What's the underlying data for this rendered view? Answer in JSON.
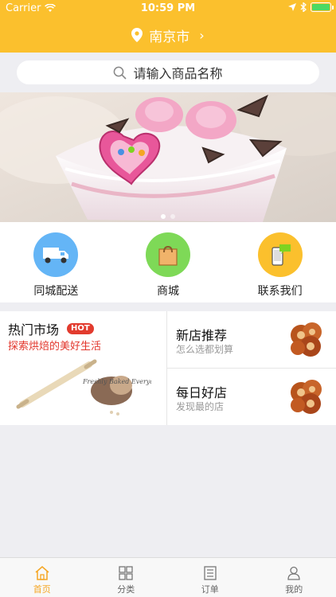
{
  "status_bar": {
    "carrier": "Carrier",
    "time": "10:59 PM"
  },
  "header": {
    "city": "南京市"
  },
  "search": {
    "placeholder": "请输入商品名称"
  },
  "quick_links": [
    {
      "label": "同城配送",
      "icon": "delivery-truck-icon",
      "color": "#64b5f6"
    },
    {
      "label": "商城",
      "icon": "shopping-bag-icon",
      "color": "#7ed957"
    },
    {
      "label": "联系我们",
      "icon": "phone-message-icon",
      "color": "#fbc02d"
    }
  ],
  "market": {
    "title": "热门市场",
    "badge": "HOT",
    "subtitle": "探索烘焙的美好生活",
    "art_text": "Freshly Baked Everyday"
  },
  "shops": [
    {
      "title": "新店推荐",
      "subtitle": "怎么选都划算"
    },
    {
      "title": "每日好店",
      "subtitle": "发现最的店"
    }
  ],
  "tabs": [
    {
      "label": "首页",
      "icon": "home-icon"
    },
    {
      "label": "分类",
      "icon": "grid-icon"
    },
    {
      "label": "订单",
      "icon": "list-icon"
    },
    {
      "label": "我的",
      "icon": "user-icon"
    }
  ],
  "colors": {
    "accent": "#fbc02d",
    "tab_active": "#f5a623",
    "hot": "#e23b2e"
  }
}
